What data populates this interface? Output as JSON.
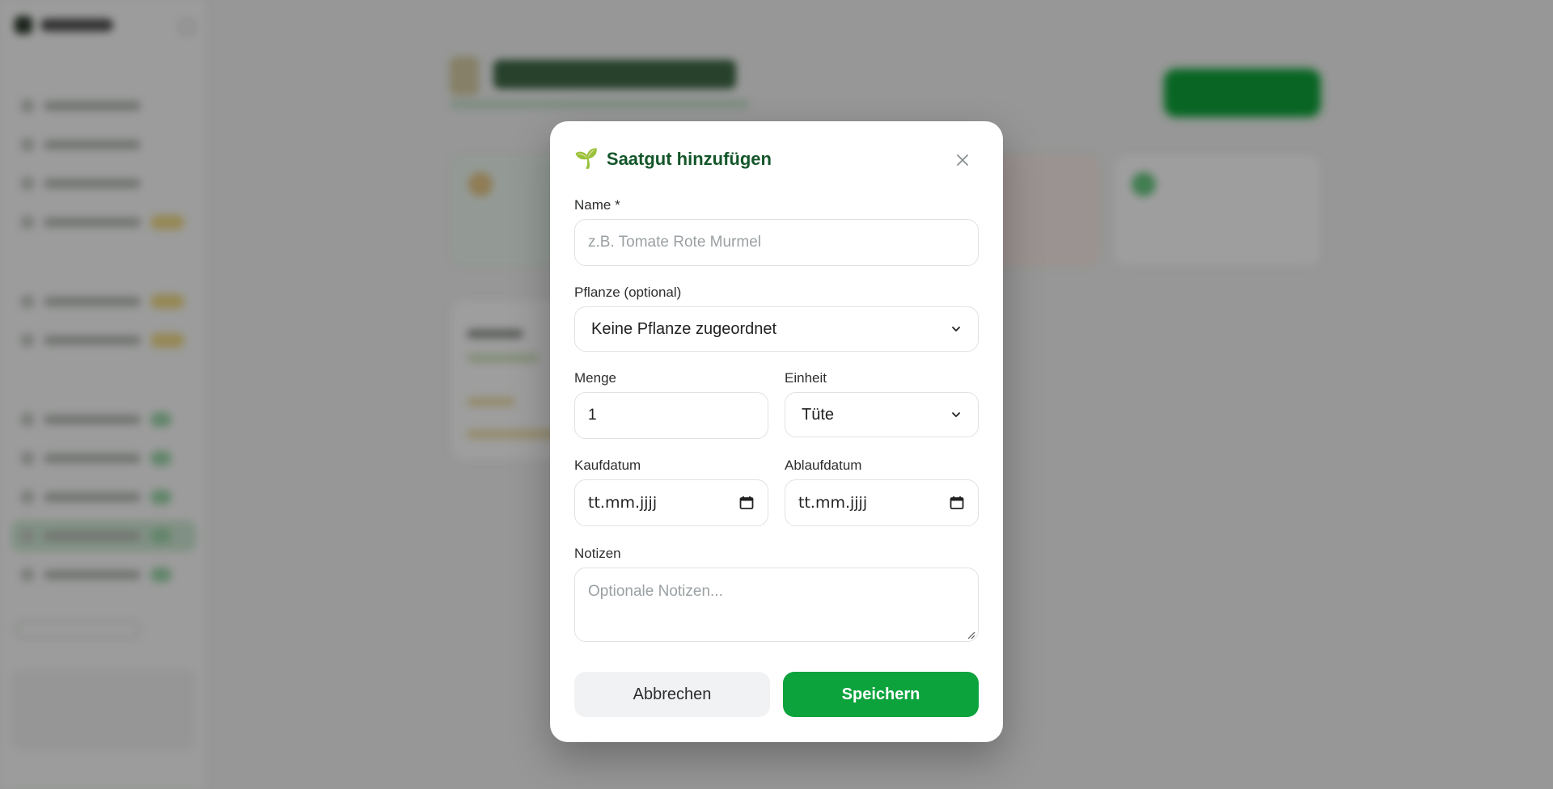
{
  "dialog": {
    "title": "Saatgut hinzufügen",
    "title_icon": "🌱",
    "name_label": "Name *",
    "name_placeholder": "z.B. Tomate Rote Murmel",
    "plant_label": "Pflanze (optional)",
    "plant_value": "Keine Pflanze zugeordnet",
    "quantity_label": "Menge",
    "quantity_value": "1",
    "unit_label": "Einheit",
    "unit_value": "Tüte",
    "purchase_label": "Kaufdatum",
    "purchase_value": "tt.mm.jjjj",
    "expiry_label": "Ablaufdatum",
    "expiry_value": "tt.mm.jjjj",
    "notes_label": "Notizen",
    "notes_placeholder": "Optionale Notizen...",
    "cancel_label": "Abbrechen",
    "save_label": "Speichern"
  },
  "colors": {
    "accent": "#0ca33d",
    "title": "#14562a",
    "overlay": "rgba(0,0,0,0.38)"
  },
  "icons": {
    "title": "seedling-icon",
    "close": "close-icon",
    "select": "chevron-down-icon",
    "date": "calendar-icon"
  }
}
